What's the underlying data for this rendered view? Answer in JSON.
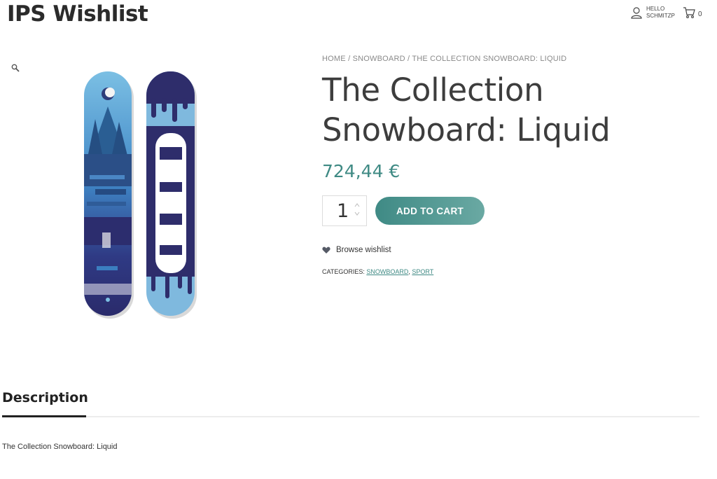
{
  "header": {
    "site_title": "IPS Wishlist",
    "account_line1": "HELLO",
    "account_line2": "SCHMITZP",
    "cart_count": "0"
  },
  "breadcrumb": {
    "home": "HOME",
    "sep1": " / ",
    "category": "SNOWBOARD",
    "sep2": " / ",
    "current": "THE COLLECTION SNOWBOARD: LIQUID"
  },
  "product": {
    "title_line1": "The Collection",
    "title_line2": "Snowboard: Liquid",
    "price": "724,44 €",
    "quantity": "1",
    "add_to_cart": "ADD TO CART",
    "wishlist_label": "Browse wishlist",
    "categories_label": "CATEGORIES: ",
    "categories": [
      "SNOWBOARD",
      "SPORT"
    ],
    "categories_sep": ", "
  },
  "tabs": {
    "description": "Description"
  },
  "description_text": "The Collection Snowboard: Liquid",
  "colors": {
    "accent": "#3f8a84",
    "board_dark": "#2e2d6b",
    "board_light": "#6fb0d6"
  }
}
